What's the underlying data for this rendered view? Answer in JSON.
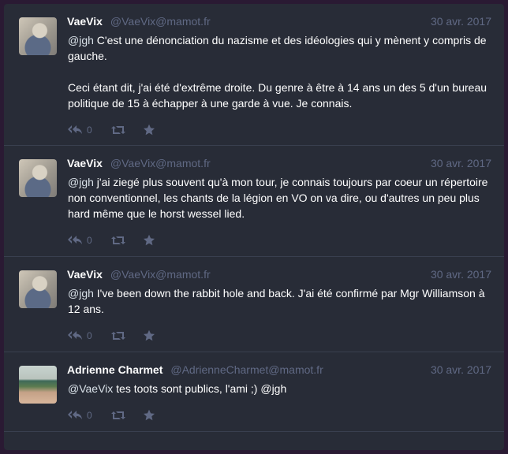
{
  "statuses": [
    {
      "display_name": "VaeVix",
      "acct": "@VaeVix@mamot.fr",
      "time": "30 avr. 2017",
      "avatar": "vaevix",
      "paragraphs": [
        {
          "mention": "@jgh",
          "text": " C'est une dénonciation du nazisme et des idéologies qui y mènent y compris de gauche."
        },
        {
          "mention": "",
          "text": "Ceci étant dit, j'ai été d'extrême droite. Du genre à être à 14 ans un des 5 d'un bureau politique de 15 à échapper à une garde à vue. Je connais."
        }
      ],
      "reply_count": "0"
    },
    {
      "display_name": "VaeVix",
      "acct": "@VaeVix@mamot.fr",
      "time": "30 avr. 2017",
      "avatar": "vaevix",
      "paragraphs": [
        {
          "mention": "@jgh",
          "text": " j'ai ziegé plus souvent qu'à mon tour, je connais toujours par coeur un répertoire non conventionnel, les chants de la légion en VO on va dire, ou d'autres un peu plus hard même que le horst wessel lied."
        }
      ],
      "reply_count": "0"
    },
    {
      "display_name": "VaeVix",
      "acct": "@VaeVix@mamot.fr",
      "time": "30 avr. 2017",
      "avatar": "vaevix",
      "paragraphs": [
        {
          "mention": "@jgh",
          "text": " I've been down the rabbit hole and back. J'ai été confirmé par Mgr Williamson à 12 ans."
        }
      ],
      "reply_count": "0"
    },
    {
      "display_name": "Adrienne Charmet",
      "acct": "@AdrienneCharmet@mamot.fr",
      "time": "30 avr. 2017",
      "avatar": "adrienne",
      "paragraphs": [
        {
          "mention": "@VaeVix",
          "text": " tes toots sont publics, l'ami ;) @jgh"
        }
      ],
      "reply_count": "0"
    }
  ],
  "icons": {
    "reply": "reply-all-icon",
    "boost": "retweet-icon",
    "favourite": "star-icon"
  },
  "colors": {
    "background": "#282c37",
    "text": "#ffffff",
    "muted": "#606984",
    "divider": "#393f4f"
  }
}
